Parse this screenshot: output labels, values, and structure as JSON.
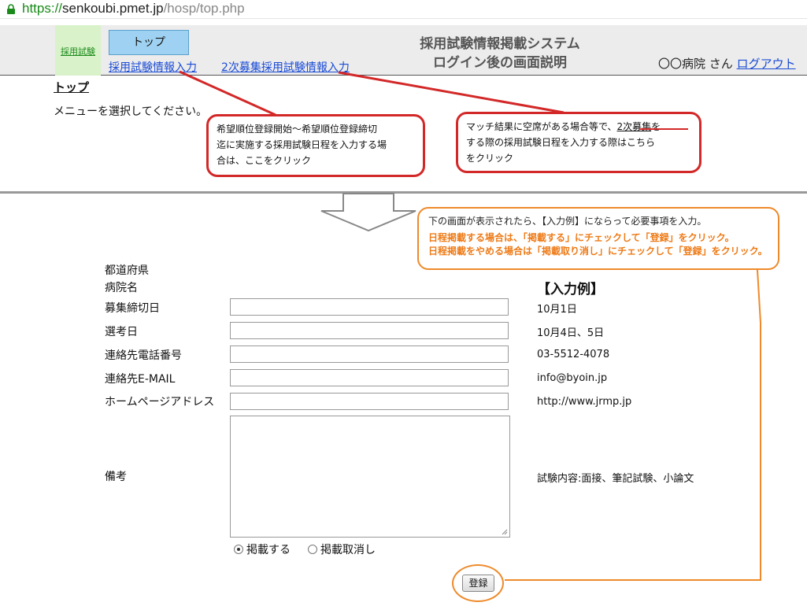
{
  "browser": {
    "url_scheme": "https://",
    "url_host": "senkoubi.pmet.jp",
    "url_path": "/hosp/top.php",
    "lock_icon": "lock-icon"
  },
  "header": {
    "side_tab": "採用試験",
    "top_button": "トップ",
    "nav_links": [
      "採用試験情報入力",
      "2次募集採用試験情報入力"
    ],
    "system_title_line1": "採用試験情報掲載システム",
    "system_title_line2": "ログイン後の画面説明",
    "user_label": "〇〇病院 さん",
    "logout": "ログアウト"
  },
  "page": {
    "title": "トップ",
    "menu_prompt": "メニューを選択してください。"
  },
  "callouts": {
    "left_lines": [
      "希望順位登録開始～希望順位登録締切",
      "迄に実施する採用試験日程を入力する場",
      "合は、ここをクリック"
    ],
    "right_prefix": "マッチ結果に空席がある場合等で、",
    "right_underlined": "2次募集",
    "right_suffix": "を",
    "right_lines": [
      "する際の採用試験日程を入力する際はこちら",
      "をクリック"
    ]
  },
  "instruction": {
    "line1": "下の画面が表示されたら、【入力例】にならって必要事項を入力。",
    "line2": "日程掲載する場合は、「掲載する」にチェックして「登録」をクリック。",
    "line3": "日程掲載をやめる場合は「掲載取り消し」にチェックして「登録」をクリック。"
  },
  "form": {
    "labels": [
      "都道府県",
      "病院名",
      "募集締切日",
      "選考日",
      "連絡先電話番号",
      "連絡先E-MAIL",
      "ホームページアドレス",
      "備考"
    ],
    "radio_publish": "掲載する",
    "radio_cancel": "掲載取消し",
    "radio_selected": "掲載する",
    "submit": "登録"
  },
  "example": {
    "heading": "【入力例】",
    "values": [
      "10月1日",
      "10月4日、5日",
      "03-5512-4078",
      "info@byoin.jp",
      "http://www.jrmp.jp",
      "試験内容:面接、筆記試験、小論文"
    ]
  },
  "colors": {
    "callout_red": "#d32828",
    "note_orange": "#ee8a2a",
    "link_blue": "#1a4bd6",
    "url_green": "#1a8a1a",
    "top_button_blue": "#9fd2f2",
    "side_tab_green": "#d9f2c9"
  }
}
